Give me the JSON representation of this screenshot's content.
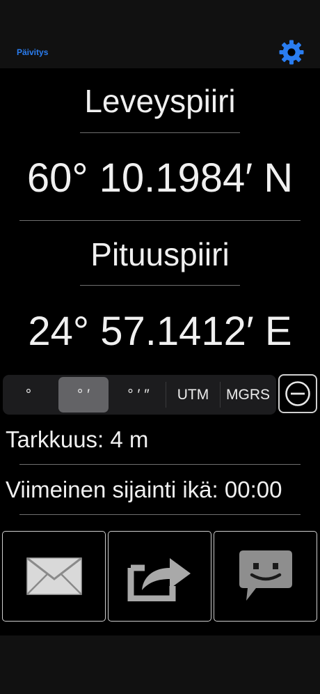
{
  "header": {
    "refresh_label": "Päivitys",
    "settings_icon": "gear-icon",
    "accent_color": "#2a7df0"
  },
  "latitude": {
    "title": "Leveyspiiri",
    "value": "60° 10.1984′ N"
  },
  "longitude": {
    "title": "Pituuspiiri",
    "value": "24° 57.1412′ E"
  },
  "format_selector": {
    "options": [
      "°",
      "° ′",
      "° ′ ″",
      "UTM",
      "MGRS"
    ],
    "selected": "° ′",
    "minus_icon": "minus-circle-icon"
  },
  "accuracy": {
    "text": "Tarkkuus: 4 m"
  },
  "last_location": {
    "text": "Viimeinen sijainti ikä: 00:00"
  },
  "actions": [
    {
      "icon": "envelope-icon"
    },
    {
      "icon": "share-icon"
    },
    {
      "icon": "message-bubble-icon"
    }
  ]
}
